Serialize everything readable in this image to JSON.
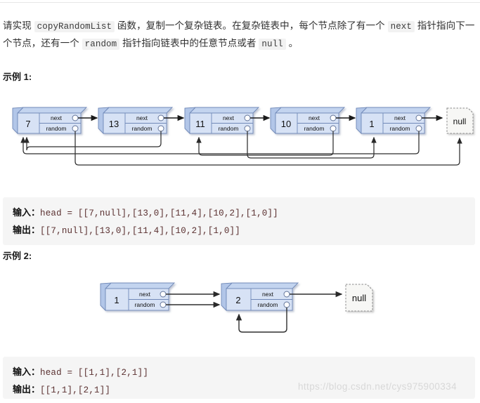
{
  "page": {
    "intro_parts": [
      {
        "type": "text",
        "value": "请实现 "
      },
      {
        "type": "code",
        "value": "copyRandomList"
      },
      {
        "type": "text",
        "value": " 函数，复制一个复杂链表。在复杂链表中，每个节点除了有一个 "
      },
      {
        "type": "code",
        "value": "next"
      },
      {
        "type": "text",
        "value": " 指针指向下一个节点，还有一个 "
      },
      {
        "type": "code",
        "value": "random"
      },
      {
        "type": "text",
        "value": " 指针指向链表中的任意节点或者 "
      },
      {
        "type": "code",
        "value": "null"
      },
      {
        "type": "text",
        "value": " 。"
      }
    ],
    "watermark": "https://blog.csdn.net/cys975900334"
  },
  "example1": {
    "title": "示例 1:",
    "input_label": "输入：",
    "input_value": "head = [[7,null],[13,0],[11,4],[10,2],[1,0]]",
    "output_label": "输出：",
    "output_value": "[[7,null],[13,0],[11,4],[10,2],[1,0]]",
    "nodes": [
      {
        "value": "7",
        "next_label": "next",
        "random_label": "random"
      },
      {
        "value": "13",
        "next_label": "next",
        "random_label": "random"
      },
      {
        "value": "11",
        "next_label": "next",
        "random_label": "random"
      },
      {
        "value": "10",
        "next_label": "next",
        "random_label": "random"
      },
      {
        "value": "1",
        "next_label": "next",
        "random_label": "random"
      }
    ],
    "null_label": "null",
    "random_targets": [
      "null",
      "0",
      "4",
      "2",
      "0"
    ]
  },
  "example2": {
    "title": "示例 2:",
    "input_label": "输入：",
    "input_value": "head = [[1,1],[2,1]]",
    "output_label": "输出：",
    "output_value": "[[1,1],[2,1]]",
    "nodes": [
      {
        "value": "1",
        "next_label": "next",
        "random_label": "random"
      },
      {
        "value": "2",
        "next_label": "next",
        "random_label": "random"
      }
    ],
    "null_label": "null",
    "random_targets": [
      "1",
      "1"
    ]
  },
  "colors": {
    "node_fill": "#c3d4ef",
    "node_body": "#d7e2f5",
    "node_stroke": "#7089b8",
    "arrow": "#1a1a1a",
    "random_arrow": "#333333",
    "null_fill": "#f7f7f5",
    "null_stroke": "#8a8a8a",
    "code_bg": "#f5f5f5"
  }
}
